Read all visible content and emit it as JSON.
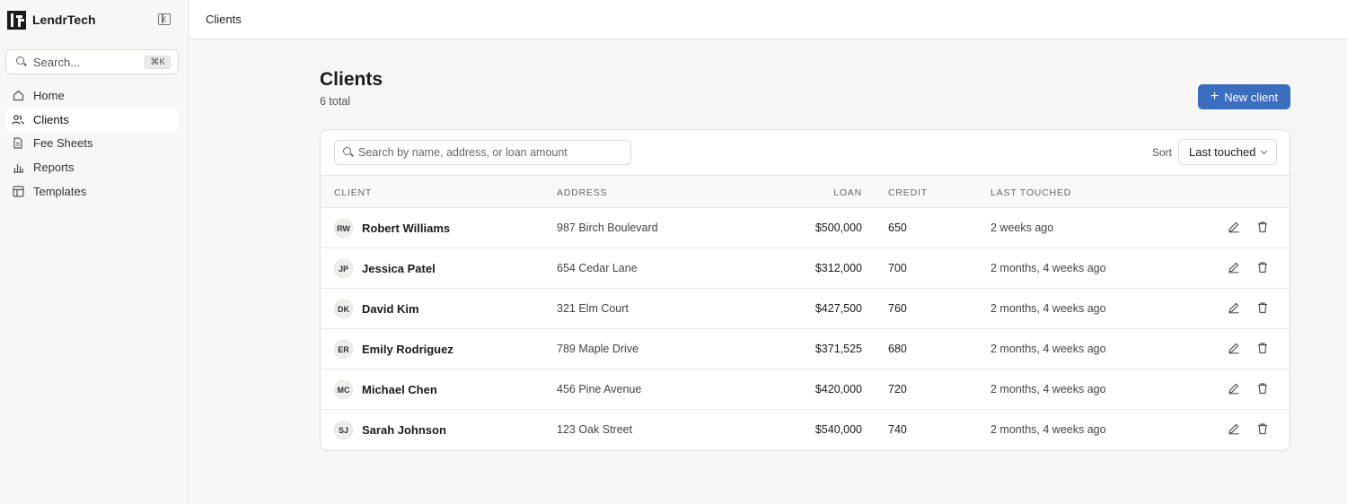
{
  "app": {
    "name": "LendrTech",
    "search_placeholder": "Search...",
    "search_shortcut": "⌘K"
  },
  "nav": [
    {
      "label": "Home",
      "icon": "home-icon",
      "active": false
    },
    {
      "label": "Clients",
      "icon": "users-icon",
      "active": true
    },
    {
      "label": "Fee Sheets",
      "icon": "document-icon",
      "active": false
    },
    {
      "label": "Reports",
      "icon": "bar-chart-icon",
      "active": false
    },
    {
      "label": "Templates",
      "icon": "layout-icon",
      "active": false
    }
  ],
  "topbar": {
    "title": "Clients"
  },
  "page": {
    "title": "Clients",
    "subtitle": "6 total",
    "new_button": "New client"
  },
  "table": {
    "search_placeholder": "Search by name, address, or loan amount",
    "sort_label": "Sort",
    "sort_value": "Last touched",
    "columns": {
      "client": "CLIENT",
      "address": "ADDRESS",
      "loan": "LOAN",
      "credit": "CREDIT",
      "last_touched": "LAST TOUCHED"
    },
    "rows": [
      {
        "initials": "RW",
        "name": "Robert Williams",
        "address": "987 Birch Boulevard",
        "loan": "$500,000",
        "credit": "650",
        "last_touched": "2 weeks ago"
      },
      {
        "initials": "JP",
        "name": "Jessica Patel",
        "address": "654 Cedar Lane",
        "loan": "$312,000",
        "credit": "700",
        "last_touched": "2 months, 4 weeks ago"
      },
      {
        "initials": "DK",
        "name": "David Kim",
        "address": "321 Elm Court",
        "loan": "$427,500",
        "credit": "760",
        "last_touched": "2 months, 4 weeks ago"
      },
      {
        "initials": "ER",
        "name": "Emily Rodriguez",
        "address": "789 Maple Drive",
        "loan": "$371,525",
        "credit": "680",
        "last_touched": "2 months, 4 weeks ago"
      },
      {
        "initials": "MC",
        "name": "Michael Chen",
        "address": "456 Pine Avenue",
        "loan": "$420,000",
        "credit": "720",
        "last_touched": "2 months, 4 weeks ago"
      },
      {
        "initials": "SJ",
        "name": "Sarah Johnson",
        "address": "123 Oak Street",
        "loan": "$540,000",
        "credit": "740",
        "last_touched": "2 months, 4 weeks ago"
      }
    ]
  },
  "colors": {
    "accent": "#3a6ec0",
    "background": "#f8f7f5",
    "surface": "#ffffff"
  }
}
